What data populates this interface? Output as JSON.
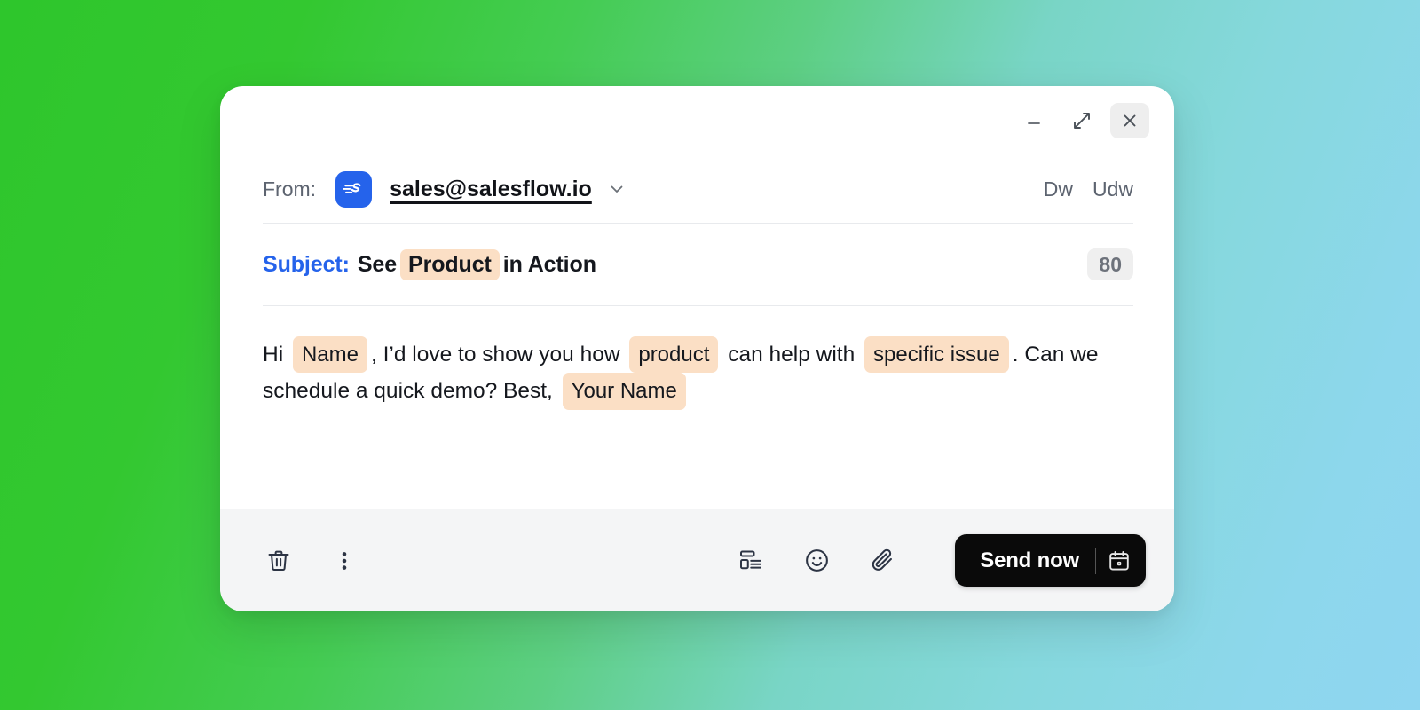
{
  "window": {
    "controls": [
      {
        "name": "minimize",
        "label": "–"
      },
      {
        "name": "expand",
        "label": "↗"
      },
      {
        "name": "close",
        "label": "✕"
      }
    ]
  },
  "from": {
    "label": "From:",
    "brand_icon": "salesflow-logo-icon",
    "address": "sales@salesflow.io",
    "chevron_icon": "chevron-down-icon",
    "actions": [
      {
        "name": "draft-action",
        "label": "Dw"
      },
      {
        "name": "undo-action",
        "label": "Udw"
      }
    ]
  },
  "subject": {
    "key": "Subject:",
    "segments": [
      {
        "text": "See",
        "highlight": false
      },
      {
        "text": "Product",
        "highlight": true
      },
      {
        "text": "in Action",
        "highlight": false
      }
    ],
    "counter": "80"
  },
  "body": {
    "segments": [
      {
        "text": "Hi ",
        "highlight": false
      },
      {
        "text": "Name",
        "highlight": true
      },
      {
        "text": ", I’d love to show you how ",
        "highlight": false
      },
      {
        "text": "product",
        "highlight": true
      },
      {
        "text": " can help with ",
        "highlight": false
      },
      {
        "text": "specific issue",
        "highlight": true
      },
      {
        "text": ". Can we schedule a quick demo? Best, ",
        "highlight": false
      },
      {
        "text": "Your Name",
        "highlight": true
      }
    ]
  },
  "footer": {
    "left_tools": [
      {
        "name": "trash-icon",
        "label": "delete"
      },
      {
        "name": "more-vertical-icon",
        "label": "more options"
      }
    ],
    "right_tools": [
      {
        "name": "template-icon",
        "label": "templates"
      },
      {
        "name": "emoji-icon",
        "label": "emoji"
      },
      {
        "name": "paperclip-icon",
        "label": "attach file"
      }
    ],
    "send": {
      "label": "Send now",
      "schedule_icon": "calendar-icon"
    }
  },
  "colors": {
    "accent_blue": "#2563eb",
    "highlight_peach": "#fbdfc5",
    "send_button": "#0a0a0a",
    "footer_bg": "#f4f5f6",
    "badge_bg": "#efefef",
    "gradient_start": "#2ec62c",
    "gradient_end": "#8fd6f0"
  }
}
